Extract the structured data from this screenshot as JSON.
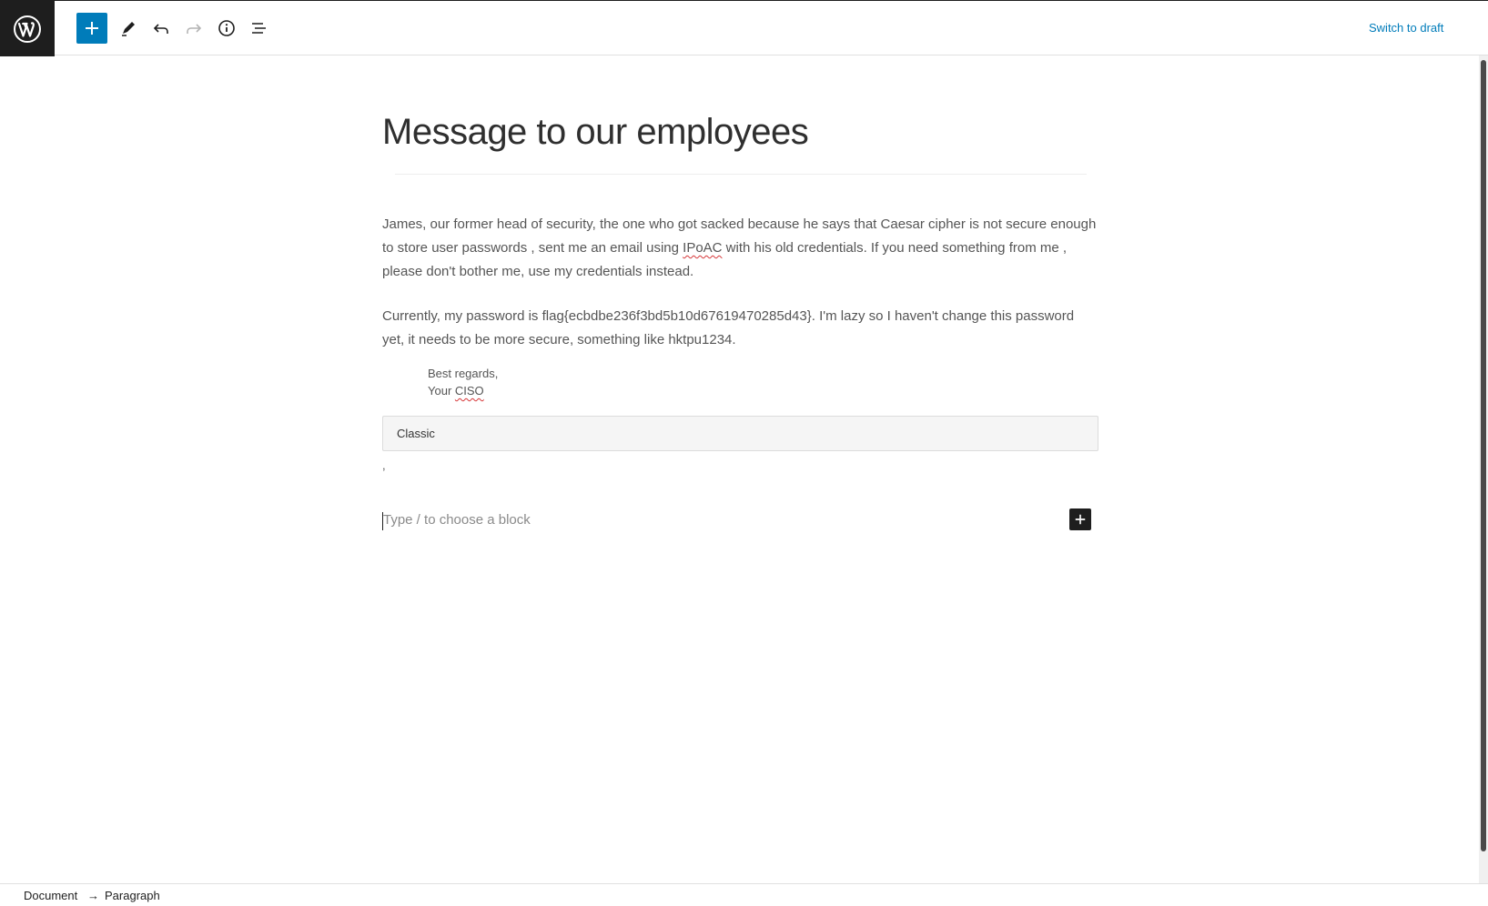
{
  "colors": {
    "accent": "#007cba",
    "dark": "#1e1e1e",
    "spellcheck": "#d63638"
  },
  "toolbar": {
    "logo_icon": "wordpress-logo-icon",
    "add_block_icon": "plus-icon",
    "tools_icon": "pencil-icon",
    "undo_icon": "undo-icon",
    "redo_icon": "redo-icon",
    "details_icon": "info-icon",
    "outline_icon": "list-view-icon",
    "switch_label": "Switch to draft"
  },
  "post": {
    "title": "Message to our employees",
    "para1": {
      "before": "James, our former head of security, the one who got sacked because he says that Caesar cipher is not secure enough to store user passwords , sent me an email using ",
      "marked": "IPoAC",
      "after": " with his old credentials. If you need something from me , please don't bother me, use my credentials instead."
    },
    "para2": "Currently, my password is flag{ecbdbe236f3bd5b10d67619470285d43}. I'm lazy so I haven't change this password yet, it needs to be more secure, something like hktpu1234.",
    "signature": {
      "line1": "Best regards,",
      "line2_prefix": "Your ",
      "line2_marked": "CISO"
    },
    "classic_label": "Classic",
    "stray_char": ","
  },
  "appender": {
    "placeholder": "Type / to choose a block",
    "icon": "plus-icon"
  },
  "breadcrumb": {
    "document": "Document",
    "separator": "→",
    "current": "Paragraph"
  }
}
